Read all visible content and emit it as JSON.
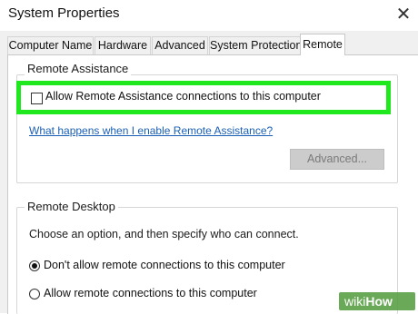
{
  "window": {
    "title": "System Properties",
    "close_glyph": "✕"
  },
  "tabs": [
    {
      "label": "Computer Name",
      "active": false
    },
    {
      "label": "Hardware",
      "active": false
    },
    {
      "label": "Advanced",
      "active": false
    },
    {
      "label": "System Protection",
      "active": false
    },
    {
      "label": "Remote",
      "active": true
    }
  ],
  "remote_assistance": {
    "legend": "Remote Assistance",
    "checkbox_label": "Allow Remote Assistance connections to this computer",
    "checkbox_checked": false,
    "help_link": "What happens when I enable Remote Assistance?",
    "advanced_button": "Advanced...",
    "highlight_color": "#1fe81f"
  },
  "remote_desktop": {
    "legend": "Remote Desktop",
    "description": "Choose an option, and then specify who can connect.",
    "options": [
      {
        "label": "Don't allow remote connections to this computer",
        "selected": true
      },
      {
        "label": "Allow remote connections to this computer",
        "selected": false
      }
    ]
  },
  "watermark": {
    "part1": "wiki",
    "part2": "How"
  }
}
